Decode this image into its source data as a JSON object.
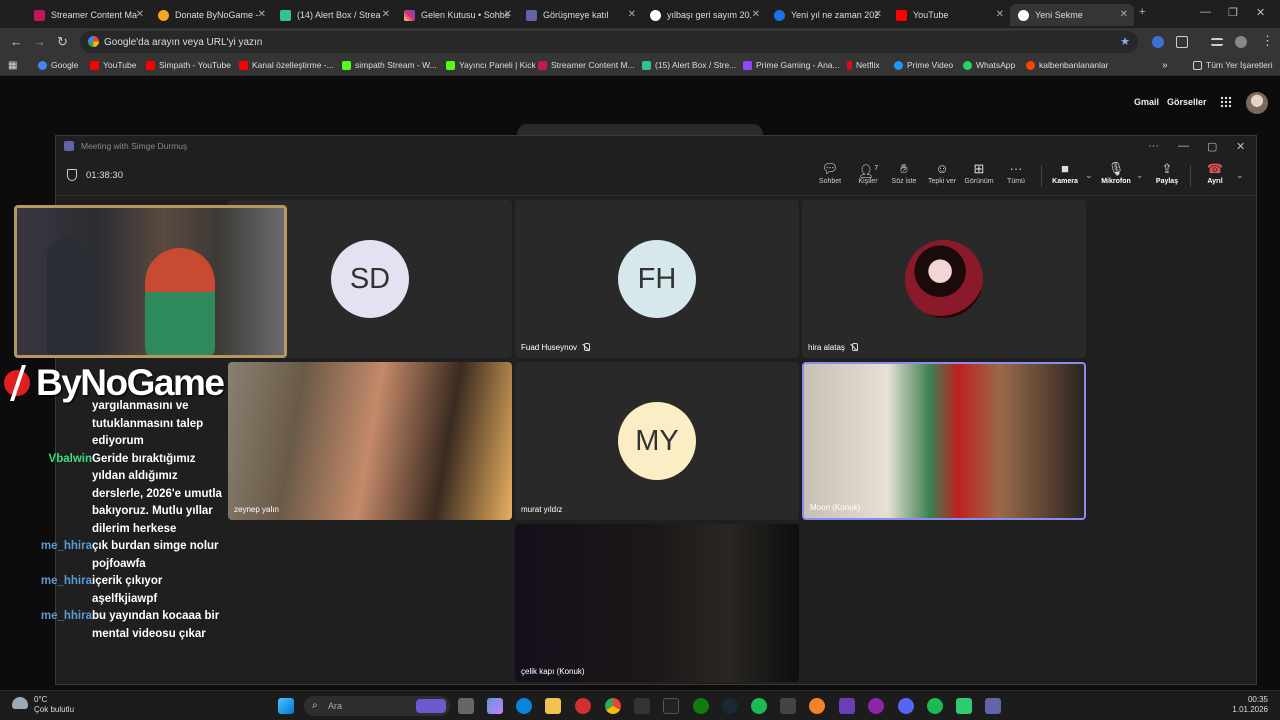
{
  "browser": {
    "tabs": [
      {
        "label": "Streamer Content Ma",
        "color": "#c2185b"
      },
      {
        "label": "Donate ByNoGame -",
        "color": "#f5a623"
      },
      {
        "label": "(14) Alert Box / Strea",
        "color": "#31c48d"
      },
      {
        "label": "Gelen Kutusu • Sohbe",
        "color": "#e1306c"
      },
      {
        "label": "Görüşmeye katıl",
        "color": "#6264a7"
      },
      {
        "label": "yılbaşı geri sayım 20.",
        "color": "#4285f4"
      },
      {
        "label": "Yeni yıl ne zaman 202",
        "color": "#1a73e8"
      },
      {
        "label": "YouTube",
        "color": "#ff0000"
      },
      {
        "label": "Yeni Sekme",
        "color": "#ffffff"
      }
    ],
    "address_placeholder": "Google'da arayın veya URL'yi yazın",
    "bookmarks": [
      {
        "label": "Google",
        "color": "#4285f4"
      },
      {
        "label": "YouTube",
        "color": "#ff0000"
      },
      {
        "label": "Simpath - YouTube",
        "color": "#ff0000"
      },
      {
        "label": "Kanal özelleştirme -...",
        "color": "#ff0000"
      },
      {
        "label": "simpath Stream - W...",
        "color": "#53fc18"
      },
      {
        "label": "Yayıncı Paneli | Kick",
        "color": "#53fc18"
      },
      {
        "label": "Streamer Content M...",
        "color": "#c2185b"
      },
      {
        "label": "(15) Alert Box / Stre...",
        "color": "#31c48d"
      },
      {
        "label": "Prime Gaming - Ana...",
        "color": "#9146ff"
      },
      {
        "label": "Netflix",
        "color": "#e50914"
      },
      {
        "label": "Prime Video",
        "color": "#1a98ff"
      },
      {
        "label": "WhatsApp",
        "color": "#25d366"
      },
      {
        "label": "kalbenbanlananlar",
        "color": "#ff4500"
      }
    ],
    "more_bookmarks": "»",
    "all_bookmarks": "Tüm Yer İşaretleri"
  },
  "google": {
    "gmail": "Gmail",
    "images": "Görseller"
  },
  "teams": {
    "window_title": "Meeting with Simge Durmuş",
    "timer": "01:38:30",
    "toolbar": {
      "chat": "Sohbet",
      "people": "Kişiler",
      "people_count": "7",
      "raise": "Söz iste",
      "react": "Tepki ver",
      "view": "Görünüm",
      "more": "Tümü",
      "camera": "Kamera",
      "mic": "Mikrofon",
      "share": "Paylaş",
      "leave": "Ayrıl"
    },
    "tiles": [
      {
        "initials": "SD",
        "name": "",
        "avatar_color": "#e6e1f2"
      },
      {
        "initials": "FH",
        "name": "Fuad Huseynov",
        "avatar_color": "#d6e8ec"
      },
      {
        "initials": "",
        "name": "hira alataş",
        "avatar_color": "#7a1020"
      },
      {
        "initials": "",
        "name": "zeynep yalın"
      },
      {
        "initials": "MY",
        "name": "murat yıldız",
        "avatar_color": "#fbeec4"
      },
      {
        "initials": "",
        "name": "Moon (Konuk)"
      },
      {
        "initials": "",
        "name": "çelik kapı (Konuk)"
      }
    ]
  },
  "overlay": {
    "brand": "ByNoGame",
    "chat": [
      {
        "user": "",
        "text": "yargılanmasını ve tutuklanmasını talep ediyorum",
        "color": "#ffffff"
      },
      {
        "user": "Vbalwin",
        "text": "Geride bıraktığımız yıldan aldığımız derslerle, 2026'e umutla bakıyoruz. Mutlu yıllar dilerim herkese",
        "color": "#3ddc84"
      },
      {
        "user": "me_hhira",
        "text": "çık burdan simge nolur pojfoawfa",
        "color": "#5b9bd5"
      },
      {
        "user": "me_hhira",
        "text": "içerik çıkıyor aşelfkjiawpf",
        "color": "#5b9bd5"
      },
      {
        "user": "me_hhira",
        "text": "bu yayından kocaaa bir mental videosu çıkar",
        "color": "#5b9bd5"
      }
    ]
  },
  "taskbar": {
    "temp": "0°C",
    "weather": "Çok bulutlu",
    "search_placeholder": "Ara",
    "time": "00:35",
    "date": "1.01.2026"
  }
}
